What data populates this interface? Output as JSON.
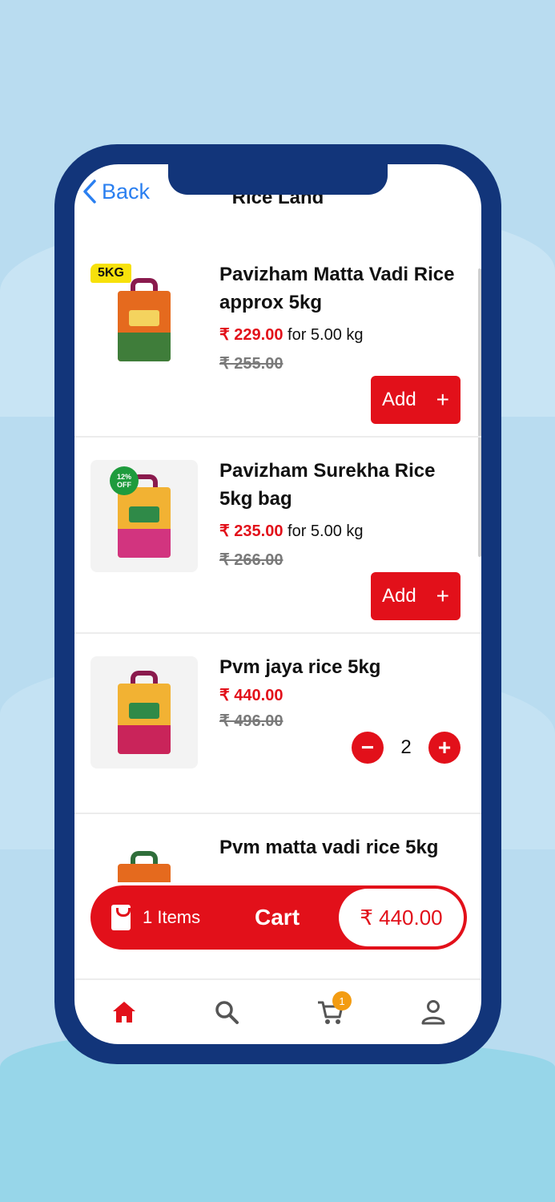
{
  "header": {
    "back_label": "Back",
    "title": "Rice Land"
  },
  "products": [
    {
      "name": "Pavizham Matta Vadi Rice approx 5kg",
      "price": "₹ 229.00",
      "unit": "for 5.00 kg",
      "old_price": "₹ 255.00",
      "badge": "5KG",
      "action": "Add",
      "bag_color": "#3f7d3a"
    },
    {
      "name": "Pavizham Surekha Rice 5kg bag",
      "price": "₹ 235.00",
      "unit": "for 5.00 kg",
      "old_price": "₹ 266.00",
      "badge": "12% OFF",
      "action": "Add",
      "bag_color": "#d2347f"
    },
    {
      "name": "Pvm jaya rice 5kg",
      "price": "₹ 440.00",
      "old_price": "₹ 496.00",
      "quantity": "2",
      "bag_color": "#c9245a"
    },
    {
      "name": "Pvm matta vadi rice 5kg",
      "bag_color": "#e56a1e"
    }
  ],
  "cart": {
    "items": "1 Items",
    "label": "Cart",
    "total": "₹ 440.00"
  },
  "tabbar": {
    "cart_count": "1",
    "active_color": "#e2101a",
    "inactive_color": "#555555"
  },
  "colors": {
    "accent": "#e2101a",
    "phone_frame": "#12357a",
    "link": "#2a7ff0"
  }
}
